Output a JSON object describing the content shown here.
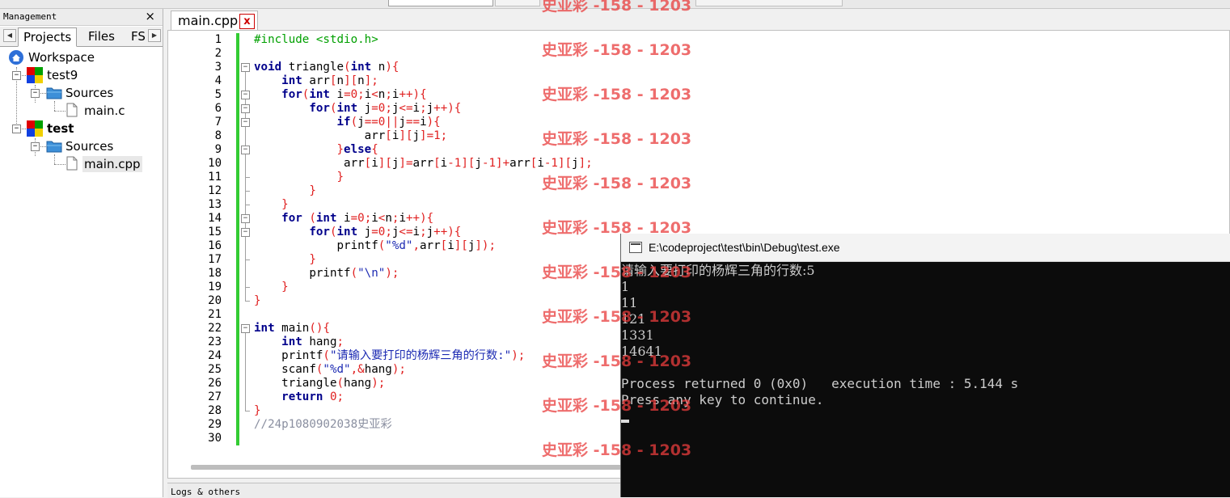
{
  "management": {
    "title": "Management",
    "close": "×",
    "tabs": [
      "Projects",
      "Files",
      "FS"
    ],
    "tree": {
      "workspace": "Workspace",
      "projects": [
        {
          "name": "test9",
          "folder": "Sources",
          "file": "main.c"
        },
        {
          "name": "test",
          "folder": "Sources",
          "file": "main.cpp"
        }
      ]
    }
  },
  "editor": {
    "tab_label": "main.cpp",
    "tab_close": "x",
    "line_numbers": [
      "1",
      "2",
      "3",
      "4",
      "5",
      "6",
      "7",
      "8",
      "9",
      "10",
      "11",
      "12",
      "13",
      "14",
      "15",
      "16",
      "17",
      "18",
      "19",
      "20",
      "21",
      "22",
      "23",
      "24",
      "25",
      "26",
      "27",
      "28",
      "29",
      "30"
    ],
    "code_lines": [
      "#include <stdio.h>",
      "",
      "void triangle(int n){",
      "    int arr[n][n];",
      "    for(int i=0;i<n;i++){",
      "        for(int j=0;j<=i;j++){",
      "            if(j==0||j==i){",
      "                arr[i][j]=1;",
      "            }else{",
      "             arr[i][j]=arr[i-1][j-1]+arr[i-1][j];",
      "            }",
      "        }",
      "    }",
      "    for (int i=0;i<n;i++){",
      "        for(int j=0;j<=i;j++){",
      "            printf(\"%d\",arr[i][j]);",
      "        }",
      "        printf(\"\\n\");",
      "    }",
      "}",
      "",
      "int main(){",
      "    int hang;",
      "    printf(\"请输入要打印的杨辉三角的行数:\");",
      "    scanf(\"%d\",&hang);",
      "    triangle(hang);",
      "    return 0;",
      "}",
      "//24p1080902038史亚彩",
      ""
    ]
  },
  "bottom_panel": {
    "title": "Logs & others"
  },
  "console": {
    "title": "E:\\codeproject\\test\\bin\\Debug\\test.exe",
    "lines": [
      "请输入要打印的杨辉三角的行数:5",
      "1",
      "11",
      "121",
      "1331",
      "14641",
      "",
      "Process returned 0 (0x0)   execution time : 5.144 s",
      "Press any key to continue."
    ]
  },
  "watermark": {
    "text": "史亚彩 -158 - 1203"
  },
  "colors": {
    "keyword": "#00008b",
    "number": "#e02020",
    "string": "#1d2bb3",
    "preprocessor": "#00a000",
    "comment": "#8a8fa0",
    "change_bar": "#33cc33",
    "watermark": "#e83c3c"
  }
}
